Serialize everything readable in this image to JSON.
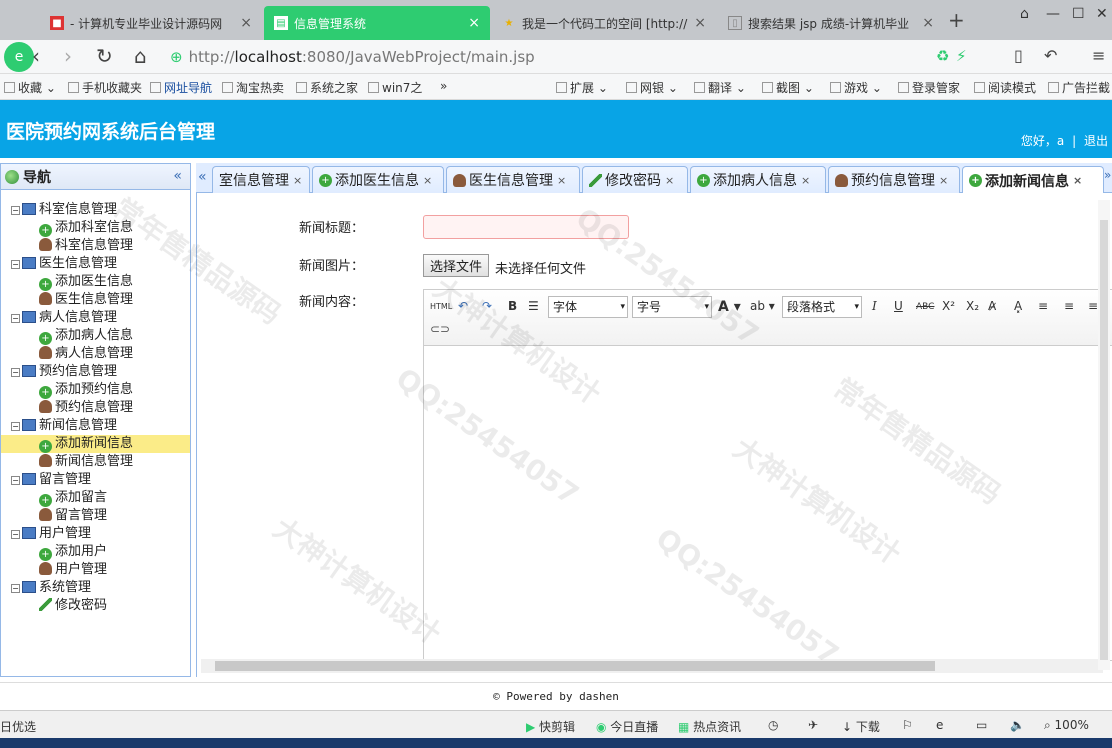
{
  "browser": {
    "tabs": [
      {
        "title": "- 计算机专业毕业设计源码网",
        "favicon": "site-icon"
      },
      {
        "title": "信息管理系统",
        "favicon": "page-icon"
      },
      {
        "title": "我是一个代码工的空间 [http://",
        "favicon": "star-icon"
      },
      {
        "title": "搜索结果 jsp 成绩-计算机毕业",
        "favicon": "page-icon"
      }
    ],
    "active_tab": 1,
    "url_host": "localhost",
    "url_rest": ":8080/JavaWebProject/main.jsp",
    "url_prefix": "http://",
    "bookmarks": [
      "收藏",
      "手机收藏夹",
      "网址导航",
      "淘宝热卖",
      "系统之家",
      "win7之",
      "扩展",
      "网银",
      "翻译",
      "截图",
      "游戏",
      "登录管家",
      "阅读模式",
      "广告拦截"
    ]
  },
  "app": {
    "title": "医院预约网系统后台管理",
    "greeting": "您好，a",
    "logout": "退出"
  },
  "nav": {
    "title": "导航",
    "groups": [
      {
        "label": "科室信息管理",
        "children": [
          {
            "label": "添加科室信息",
            "icon": "add-icon"
          },
          {
            "label": "科室信息管理",
            "icon": "user-icon"
          }
        ]
      },
      {
        "label": "医生信息管理",
        "children": [
          {
            "label": "添加医生信息",
            "icon": "add-icon"
          },
          {
            "label": "医生信息管理",
            "icon": "user-icon"
          }
        ]
      },
      {
        "label": "病人信息管理",
        "children": [
          {
            "label": "添加病人信息",
            "icon": "add-icon"
          },
          {
            "label": "病人信息管理",
            "icon": "user-icon"
          }
        ]
      },
      {
        "label": "预约信息管理",
        "children": [
          {
            "label": "添加预约信息",
            "icon": "add-icon"
          },
          {
            "label": "预约信息管理",
            "icon": "user-icon"
          }
        ]
      },
      {
        "label": "新闻信息管理",
        "children": [
          {
            "label": "添加新闻信息",
            "icon": "add-icon",
            "selected": true
          },
          {
            "label": "新闻信息管理",
            "icon": "user-icon"
          }
        ]
      },
      {
        "label": "留言管理",
        "children": [
          {
            "label": "添加留言",
            "icon": "add-icon"
          },
          {
            "label": "留言管理",
            "icon": "user-icon"
          }
        ]
      },
      {
        "label": "用户管理",
        "children": [
          {
            "label": "添加用户",
            "icon": "add-icon"
          },
          {
            "label": "用户管理",
            "icon": "user-icon"
          }
        ]
      },
      {
        "label": "系统管理",
        "children": [
          {
            "label": "修改密码",
            "icon": "pencil-icon"
          }
        ]
      }
    ]
  },
  "tabs": [
    {
      "label": "室信息管理",
      "icon": ""
    },
    {
      "label": "添加医生信息",
      "icon": "add-icon"
    },
    {
      "label": "医生信息管理",
      "icon": "user-icon"
    },
    {
      "label": "修改密码",
      "icon": "pencil-icon"
    },
    {
      "label": "添加病人信息",
      "icon": "add-icon"
    },
    {
      "label": "预约信息管理",
      "icon": "user-icon"
    },
    {
      "label": "添加新闻信息",
      "icon": "add-icon",
      "active": true
    }
  ],
  "form": {
    "title_label": "新闻标题：",
    "title_value": "",
    "image_label": "新闻图片：",
    "file_button": "选择文件",
    "file_status": "未选择任何文件",
    "content_label": "新闻内容："
  },
  "editor": {
    "html_btn": "HTML",
    "font_select": "字体",
    "size_select": "字号",
    "format_select": "段落格式"
  },
  "footer": "© Powered by dashen",
  "statusbar": {
    "left": "日优选",
    "items": [
      "快剪辑",
      "今日直播",
      "热点资讯",
      "下载"
    ],
    "zoom": "100%"
  },
  "watermarks": [
    "QQ:25454057",
    "常年售精品源码",
    "大神计算机设计"
  ]
}
